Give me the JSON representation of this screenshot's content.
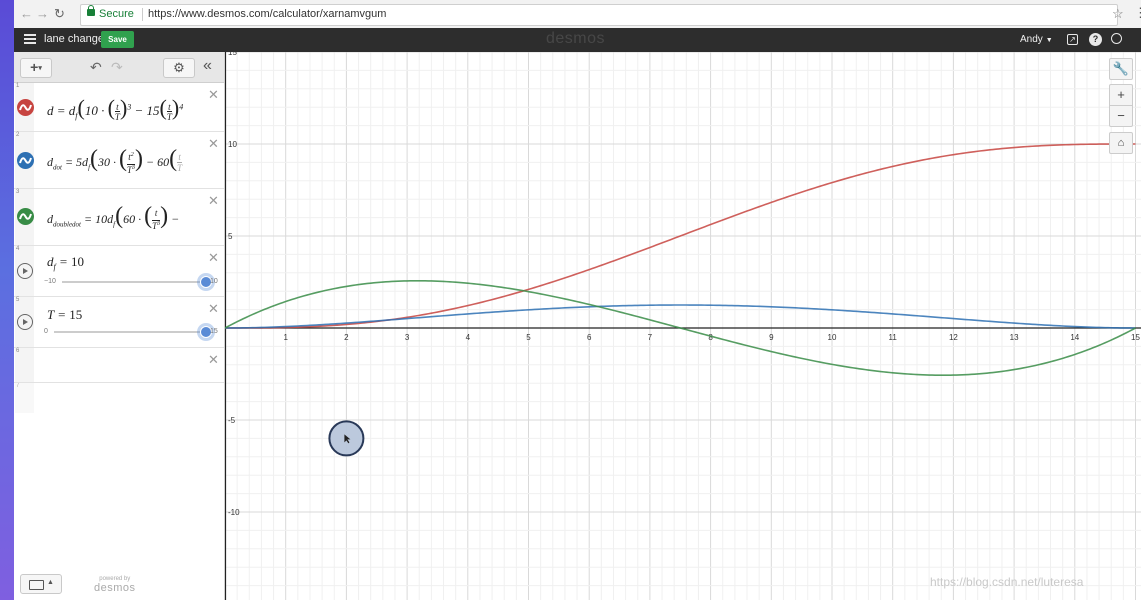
{
  "browser": {
    "secure_label": "Secure",
    "url": "https://www.desmos.com/calculator/xarnamvgum"
  },
  "header": {
    "title": "lane change",
    "save_label": "Save",
    "brand": "desmos",
    "user": "Andy"
  },
  "toolbar": {
    "add_label": "+",
    "icons": [
      "undo-icon",
      "redo-icon",
      "gear-icon",
      "collapse-icon"
    ]
  },
  "expressions": [
    {
      "index": "1",
      "color": "#c74440",
      "latex": "d = d_f(10·(t/T)^3 − 15(t/T)^4 …"
    },
    {
      "index": "2",
      "color": "#2d70b3",
      "latex": "d_dot = 5d_f(30·(t^2/T^3) − 60(t/T …"
    },
    {
      "index": "3",
      "color": "#388c46",
      "latex": "d_doubledot = 10d_f(60·(t/T^3) − …"
    },
    {
      "index": "4",
      "var": "d",
      "sub": "f",
      "value": "10",
      "min": "−10",
      "max": "10",
      "fraction": 1.0
    },
    {
      "index": "5",
      "var": "T",
      "value": "15",
      "min": "0",
      "max": "15",
      "fraction": 1.0
    },
    {
      "index": "6"
    },
    {
      "index": "7"
    }
  ],
  "footer": {
    "powered_by": "powered by",
    "brand": "desmos"
  },
  "graph": {
    "x_range": [
      0,
      15
    ],
    "y_range": [
      -14.5,
      15
    ],
    "x_ticks": [
      "1",
      "2",
      "3",
      "4",
      "5",
      "6",
      "7",
      "8",
      "9",
      "10",
      "11",
      "12",
      "13",
      "14",
      "15"
    ],
    "y_ticks": [
      {
        "v": 15,
        "label": "15"
      },
      {
        "v": 10,
        "label": "10"
      },
      {
        "v": 5,
        "label": "5"
      },
      {
        "v": -5,
        "label": "-5"
      },
      {
        "v": -10,
        "label": "-10"
      }
    ],
    "params": {
      "df": 10,
      "T": 15
    },
    "series_colors": {
      "position": "#c74440",
      "velocity": "#2d70b3",
      "acceleration": "#388c46"
    },
    "cursor_point": {
      "x": 2,
      "y": -6
    },
    "watermark": "https://blog.csdn.net/luteresa"
  }
}
